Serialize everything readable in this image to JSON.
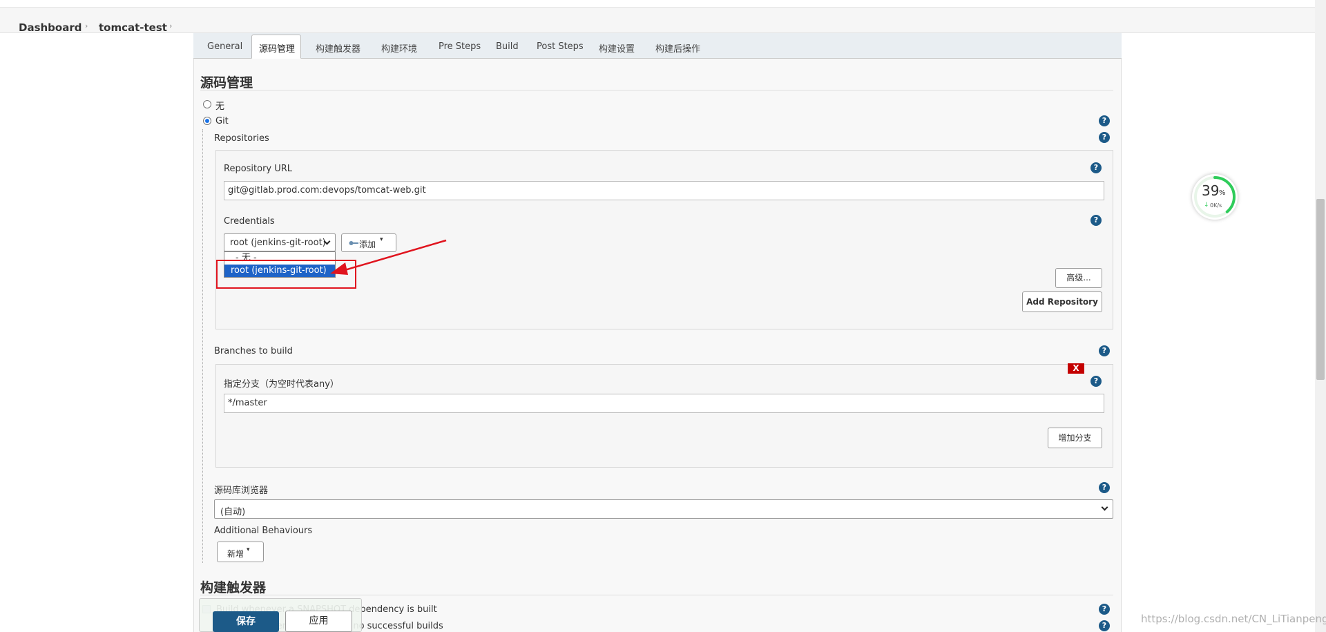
{
  "breadcrumb": {
    "items": [
      "Dashboard",
      "tomcat-test"
    ]
  },
  "tabs": [
    "General",
    "源码管理",
    "构建触发器",
    "构建环境",
    "Pre Steps",
    "Build",
    "Post Steps",
    "构建设置",
    "构建后操作"
  ],
  "scm": {
    "section_title": "源码管理",
    "option_none": "无",
    "option_git": "Git",
    "repositories_label": "Repositories",
    "repo_url_label": "Repository URL",
    "repo_url_value": "git@gitlab.prod.com:devops/tomcat-web.git",
    "credentials_label": "Credentials",
    "credentials_selected": "root (jenkins-git-root)",
    "credentials_options": [
      "- 无 -",
      "root (jenkins-git-root)"
    ],
    "add_button": "添加",
    "advanced_button": "高级...",
    "add_repository_button": "Add Repository",
    "branches_label": "Branches to build",
    "branch_spec_label": "指定分支（为空时代表any）",
    "branch_spec_value": "*/master",
    "delete_branch": "X",
    "add_branch_button": "增加分支",
    "browser_label": "源码库浏览器",
    "browser_value": "(自动)",
    "behaviours_label": "Additional Behaviours",
    "behaviours_add": "新增"
  },
  "triggers": {
    "section_title": "构建触发器",
    "items": [
      "Build whenever a SNAPSHOT dependency is built",
      "Build whenever upstream has no successful builds"
    ]
  },
  "footer": {
    "save": "保存",
    "apply": "应用"
  },
  "help_glyph": "?",
  "gauge": {
    "percent": "39",
    "percent_unit": "%",
    "rate": "0K/s"
  },
  "watermark": "https://blog.csdn.net/CN_LiTianpeng",
  "colors": {
    "accent": "#1c5a88",
    "annotation": "#e0141e",
    "selected_option": "#1e63c7"
  }
}
